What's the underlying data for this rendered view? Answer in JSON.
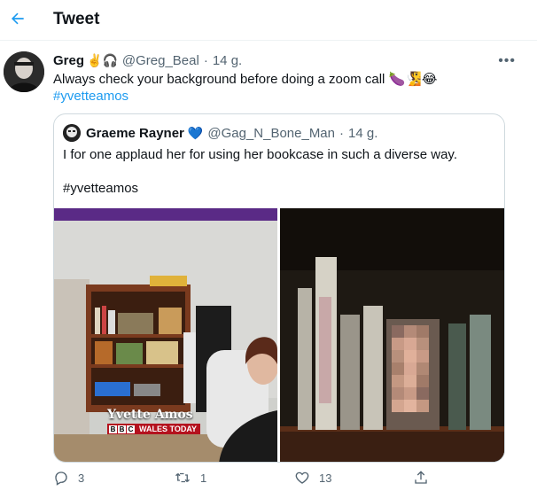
{
  "header": {
    "title": "Tweet"
  },
  "tweet": {
    "author_name": "Greg",
    "author_emoji": "✌️🎧",
    "handle": "@Greg_Beal",
    "separator": "·",
    "time": "14 g.",
    "text": "Always check your background before doing a zoom call 🍆🧏😂",
    "hashtag": "#yvetteamos"
  },
  "quote": {
    "author_name": "Graeme Rayner",
    "verified_emoji": "💙",
    "handle": "@Gag_N_Bone_Man",
    "separator": "·",
    "time": "14 g.",
    "text": "I for one applaud her for using her bookcase in such a diverse way.",
    "hashtag": "#yvetteamos",
    "media_left": {
      "caption_name": "Yvette Amos",
      "caption_letters": [
        "B",
        "B",
        "C"
      ],
      "caption_channel": "WALES TODAY"
    }
  },
  "actions": {
    "reply_count": "3",
    "retweet_count": "1",
    "like_count": "13"
  },
  "colors": {
    "accent": "#1d9bf0",
    "muted": "#536471",
    "border": "#cfd9de"
  },
  "icons": [
    "back-arrow-icon",
    "more-icon",
    "reply-icon",
    "retweet-icon",
    "like-icon",
    "share-icon"
  ]
}
